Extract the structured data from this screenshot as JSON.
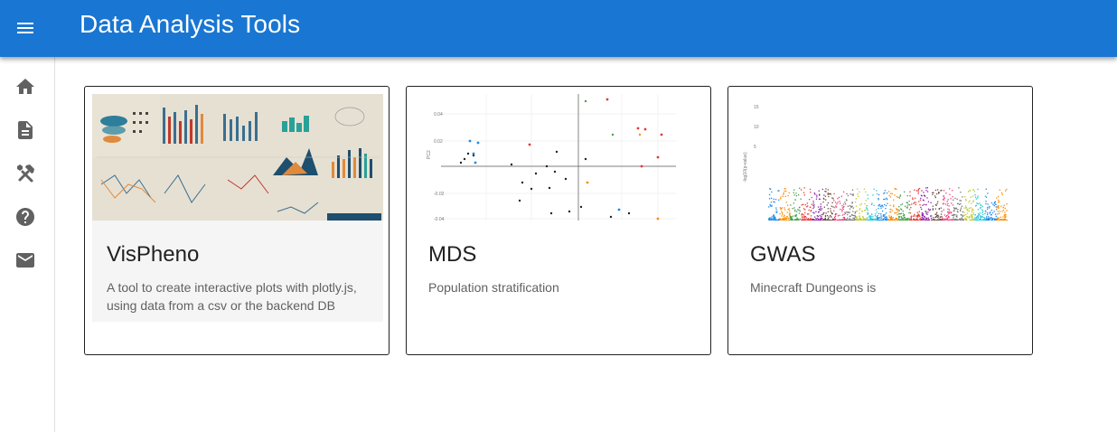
{
  "app": {
    "title": "Data Analysis Tools"
  },
  "colors": {
    "appbar": "#1976d2",
    "nav_icon": "#616161"
  },
  "nav": [
    {
      "name": "home",
      "icon": "home-icon"
    },
    {
      "name": "docs",
      "icon": "document-icon"
    },
    {
      "name": "tools",
      "icon": "tools-icon"
    },
    {
      "name": "help",
      "icon": "help-icon"
    },
    {
      "name": "contact",
      "icon": "mail-icon"
    }
  ],
  "cards": [
    {
      "title": "VisPheno",
      "description": "A tool to create interactive plots with plotly.js, using data from a csv or the backend DB",
      "image": "infographic-collage"
    },
    {
      "title": "MDS",
      "description": "Population stratification",
      "image": "mds-scatter-plot"
    },
    {
      "title": "GWAS",
      "description": "Minecraft Dungeons is",
      "image": "manhattan-plot"
    }
  ]
}
